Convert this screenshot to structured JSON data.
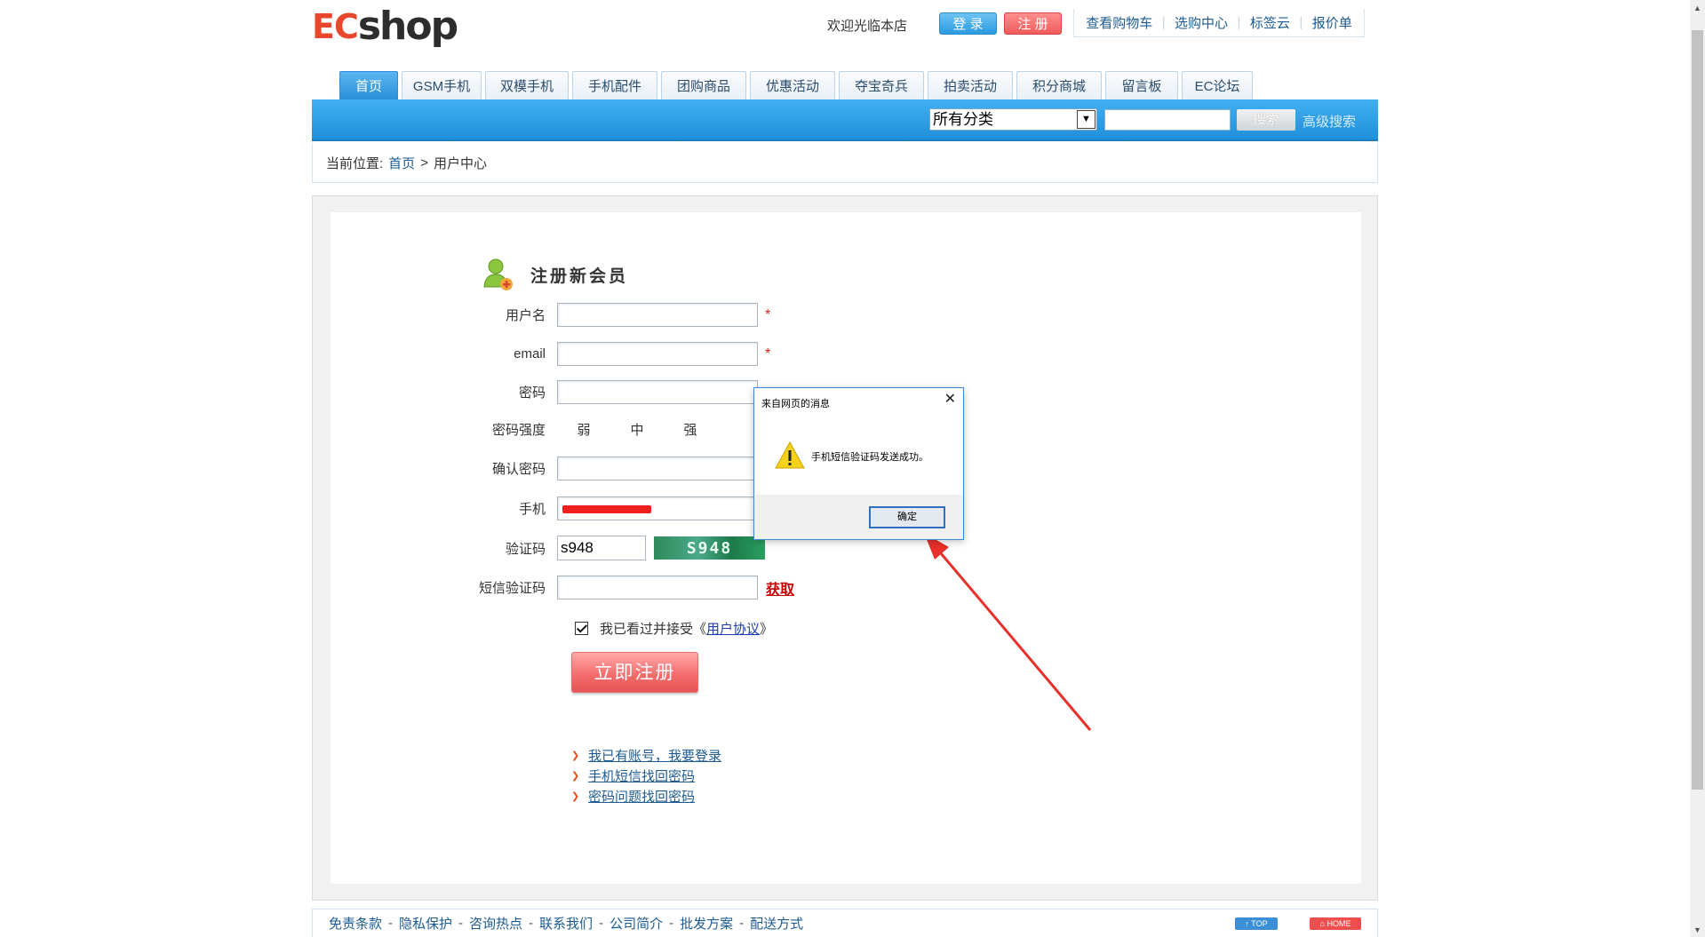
{
  "header": {
    "logo_ec": "EC",
    "logo_shop": "shop",
    "welcome": "欢迎光临本店",
    "login_label": "登 录",
    "register_label": "注 册",
    "top_links": [
      "查看购物车",
      "选购中心",
      "标签云",
      "报价单"
    ]
  },
  "nav": {
    "tabs": [
      "首页",
      "GSM手机",
      "双模手机",
      "手机配件",
      "团购商品",
      "优惠活动",
      "夺宝奇兵",
      "拍卖活动",
      "积分商城",
      "留言板",
      "EC论坛"
    ],
    "active_tab": "首页"
  },
  "search": {
    "category_selected": "所有分类",
    "search_button": "搜索",
    "advanced_link": "高级搜索"
  },
  "breadcrumb": {
    "prefix": "当前位置:",
    "home": "首页",
    "separator": ">",
    "current": "用户中心"
  },
  "register": {
    "title": "注册新会员",
    "fields": {
      "username_label": "用户名",
      "email_label": "email",
      "password_label": "密码",
      "strength_label": "密码强度",
      "strength_levels": [
        "弱",
        "中",
        "强"
      ],
      "confirm_label": "确认密码",
      "phone_label": "手机",
      "captcha_label": "验证码",
      "captcha_value": "s948",
      "captcha_image_text": "S948",
      "sms_label": "短信验证码",
      "get_code": "获取",
      "required_mark": "*"
    },
    "agree_prefix": "我已看过并接受《",
    "agree_link": "用户协议",
    "agree_suffix": "》",
    "submit": "立即注册",
    "links": [
      "我已有账号，我要登录",
      "手机短信找回密码",
      "密码问题找回密码"
    ]
  },
  "footer": {
    "links": [
      "免责条款",
      "隐私保护",
      "咨询热点",
      "联系我们",
      "公司简介",
      "批发方案",
      "配送方式"
    ],
    "top_label": "↑ TOP",
    "home_label": "⌂ HOME"
  },
  "dialog": {
    "title": "来自网页的消息",
    "message": "手机短信验证码发送成功。",
    "ok_label": "确定"
  },
  "colors": {
    "nav_blue": "#2a8fd8",
    "submit_red": "#f36a6a",
    "annotation_arrow": "#e8302a"
  }
}
